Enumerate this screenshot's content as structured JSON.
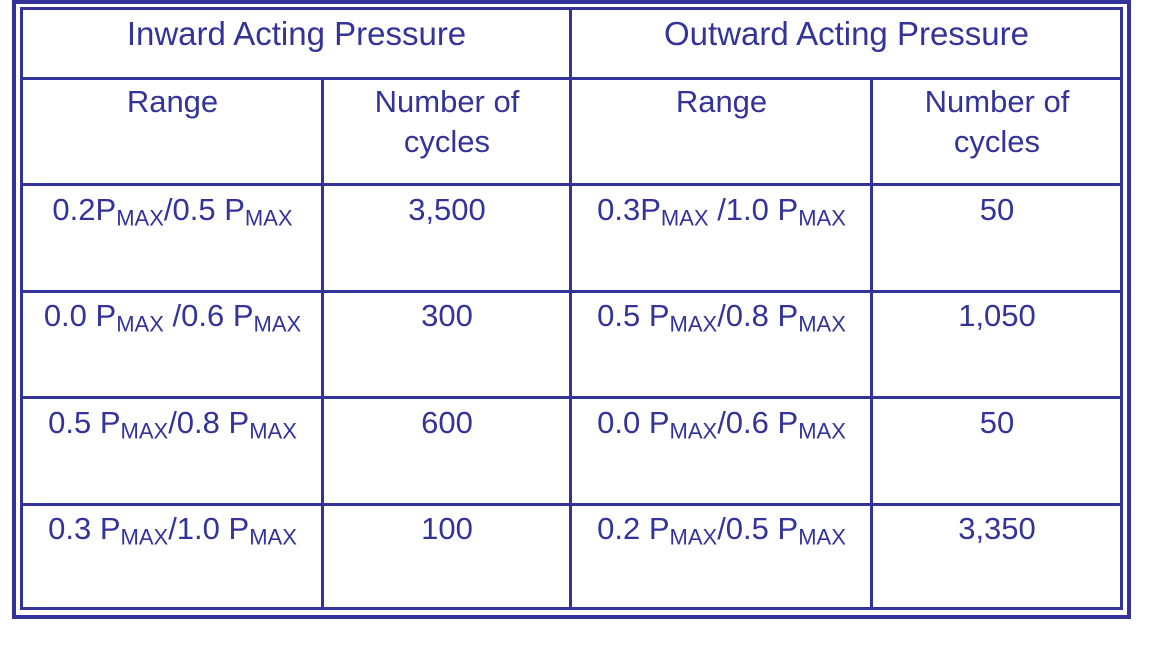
{
  "table": {
    "groups": [
      {
        "label": "Inward Acting Pressure"
      },
      {
        "label": "Outward Acting Pressure"
      }
    ],
    "columns": [
      {
        "line1": "Range",
        "line2": ""
      },
      {
        "line1": "Number of",
        "line2": "cycles"
      },
      {
        "line1": "Range",
        "line2": ""
      },
      {
        "line1": "Number of",
        "line2": "cycles"
      }
    ],
    "subscript": "MAX",
    "rows": [
      {
        "inward": {
          "range": {
            "a": "0.2P",
            "b": "/0.5 P"
          },
          "cycles": "3,500"
        },
        "outward": {
          "range": {
            "a": "0.3P",
            "b": " /1.0 P"
          },
          "cycles": "50"
        }
      },
      {
        "inward": {
          "range": {
            "a": "0.0 P",
            "b": " /0.6 P"
          },
          "cycles": "300"
        },
        "outward": {
          "range": {
            "a": "0.5 P",
            "b": "/0.8 P"
          },
          "cycles": "1,050"
        }
      },
      {
        "inward": {
          "range": {
            "a": "0.5 P",
            "b": "/0.8 P"
          },
          "cycles": "600"
        },
        "outward": {
          "range": {
            "a": "0.0 P",
            "b": "/0.6 P"
          },
          "cycles": "50"
        }
      },
      {
        "inward": {
          "range": {
            "a": "0.3 P",
            "b": "/1.0 P"
          },
          "cycles": "100"
        },
        "outward": {
          "range": {
            "a": "0.2 P",
            "b": "/0.5 P"
          },
          "cycles": "3,350"
        }
      }
    ]
  },
  "colors": {
    "line": "#333399",
    "text": "#333399",
    "background": "#ffffff"
  }
}
